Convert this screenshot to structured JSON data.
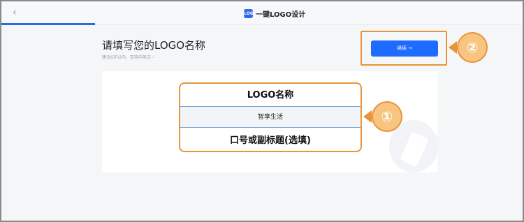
{
  "header": {
    "back_icon": "chevron-left-icon",
    "app_logo_text": "LOGO",
    "app_name": "一键LOGO设计"
  },
  "page": {
    "title": "请填写您的LOGO名称",
    "subtitle": "建议6字以内，支持中英文~"
  },
  "actions": {
    "continue_label": "继续 →"
  },
  "form": {
    "logo_name_label": "LOGO名称",
    "logo_name_value": "智享生活",
    "slogan_label": "口号或副标题(选填)"
  },
  "annotations": {
    "badge_1": "①",
    "badge_2": "②"
  },
  "colors": {
    "accent": "#1e6bff",
    "highlight": "#e8943a",
    "badge_fill": "#f7c580"
  }
}
